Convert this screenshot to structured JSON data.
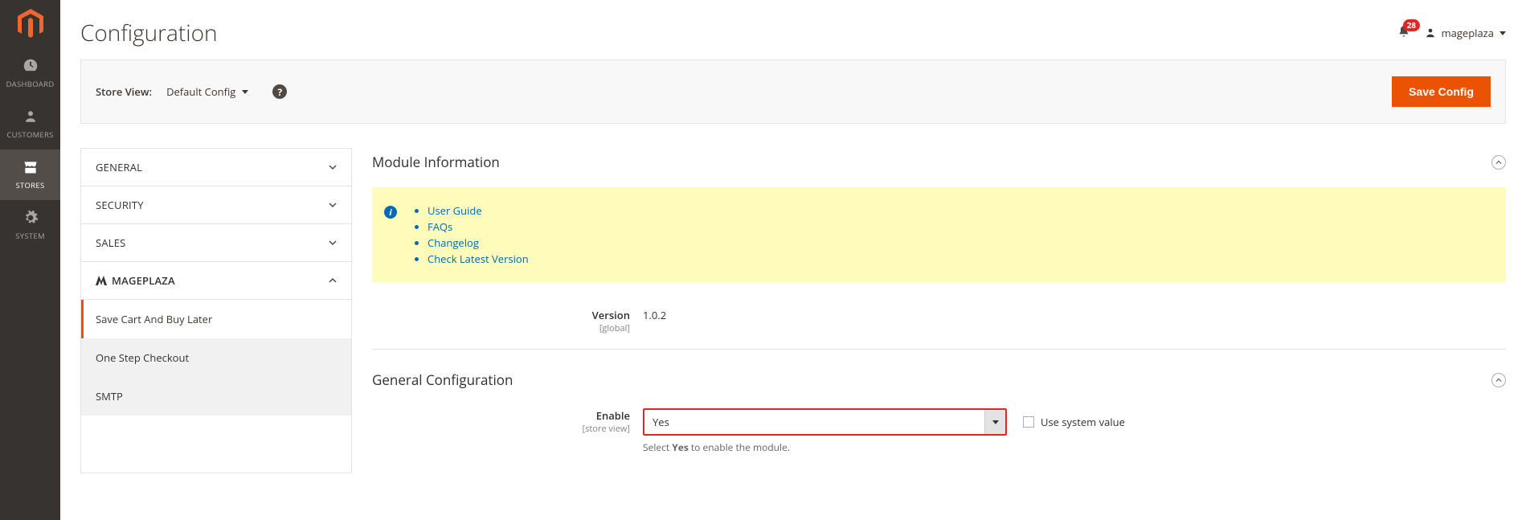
{
  "sidebar": {
    "items": [
      {
        "label": "Dashboard"
      },
      {
        "label": "Customers"
      },
      {
        "label": "Stores"
      },
      {
        "label": "System"
      }
    ]
  },
  "header": {
    "title": "Configuration",
    "notif_count": "28",
    "admin_user": "mageplaza"
  },
  "storebar": {
    "label": "Store View:",
    "value": "Default Config",
    "save_btn": "Save Config"
  },
  "nav": {
    "sections": [
      {
        "title": "General"
      },
      {
        "title": "Security"
      },
      {
        "title": "Sales"
      },
      {
        "title": "Mageplaza"
      }
    ],
    "subitems": [
      {
        "label": "Save Cart And Buy Later"
      },
      {
        "label": "One Step Checkout"
      },
      {
        "label": "SMTP"
      }
    ]
  },
  "module_info": {
    "title": "Module Information",
    "links": [
      "User Guide",
      "FAQs",
      "Changelog",
      "Check Latest Version"
    ],
    "version_label": "Version",
    "version_scope": "[global]",
    "version_value": "1.0.2"
  },
  "general_config": {
    "title": "General Configuration",
    "enable_label": "Enable",
    "enable_scope": "[store view]",
    "enable_value": "Yes",
    "use_system": "Use system value",
    "help_prefix": "Select ",
    "help_bold": "Yes",
    "help_suffix": " to enable the module."
  }
}
